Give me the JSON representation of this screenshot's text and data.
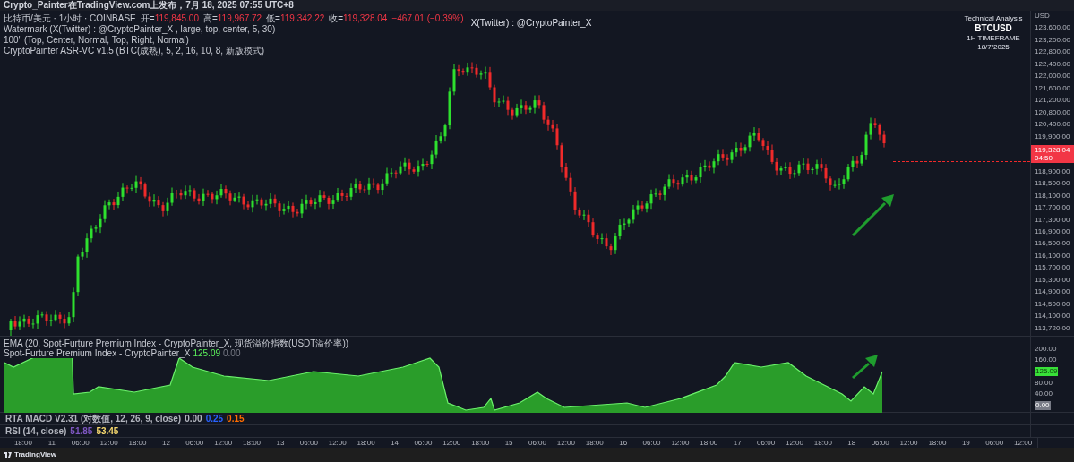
{
  "header": {
    "text": "Crypto_Painter在TradingView.com上发布，7月 18, 2025 07:55 UTC+8"
  },
  "legend": {
    "symbol": "比特币/美元 · 1小时 · COINBASE",
    "ohlc": [
      {
        "label": "开=",
        "value": "119,845.00"
      },
      {
        "label": "高=",
        "value": "119,967.72"
      },
      {
        "label": "低=",
        "value": "119,342.22"
      },
      {
        "label": "收=",
        "value": "119,328.04"
      }
    ],
    "change": "−467.01 (−0.39%)",
    "indicators": [
      "Watermark (X(Twitter) : @CryptoPainter_X , large, top, center, 5, 30)",
      "100\" (Top, Center, Normal, Top, Right, Normal)",
      "CryptoPainter ASR-VC v1.5 (BTC(成熟), 5, 2, 16, 10, 8, 新版模式)"
    ]
  },
  "watermark": "X(Twitter) : @CryptoPainter_X",
  "info_box": {
    "title": "Technical Analysis",
    "symbol": "BTCUSD",
    "timeframe": "1H TIMEFRAME",
    "date": "18/7/2025"
  },
  "price_axis": {
    "currency": "USD",
    "ticks_above": [
      "123,600.00",
      "123,200.00",
      "122,800.00",
      "122,400.00",
      "122,000.00",
      "121,600.00",
      "121,200.00",
      "120,800.00",
      "120,400.00",
      "119,900.00"
    ],
    "ticks_below": [
      "118,900.00",
      "118,500.00",
      "118,100.00",
      "117,700.00",
      "117,300.00",
      "116,900.00",
      "116,500.00",
      "116,100.00",
      "115,700.00",
      "115,300.00",
      "114,900.00",
      "114,500.00",
      "114,100.00",
      "113,720.00"
    ],
    "last_price": "119,328.04",
    "countdown": "04:50"
  },
  "premium_panel": {
    "ema_legend": "EMA (20, Spot-Furture Premium Index - CryptoPainter_X, 现货溢价指数(USDT溢价率))",
    "name": "Spot-Furture Premium Index - CryptoPainter_X",
    "value": "125.09",
    "value_2": "0.00",
    "ticks_above": [
      "200.00",
      "160.00"
    ],
    "value_badge": "125.09",
    "ticks_below": [
      "80.00",
      "40.00"
    ],
    "zero_badge": "0.00"
  },
  "macd": {
    "name": "RTA MACD V2.31 (对数值, 12, 26, 9, close)",
    "values": [
      {
        "text": "0.00",
        "color": "#b2b5be"
      },
      {
        "text": "0.25",
        "color": "#2962ff"
      },
      {
        "text": "0.15",
        "color": "#ff6d00"
      }
    ]
  },
  "rsi": {
    "name": "RSI (14, close)",
    "values": [
      {
        "text": "51.85",
        "color": "#7e57c2"
      },
      {
        "text": "53.45",
        "color": "#f5d76e"
      }
    ]
  },
  "time_axis": [
    "18:00",
    "11",
    "06:00",
    "12:00",
    "18:00",
    "12",
    "06:00",
    "12:00",
    "18:00",
    "13",
    "06:00",
    "12:00",
    "18:00",
    "14",
    "06:00",
    "12:00",
    "18:00",
    "15",
    "06:00",
    "12:00",
    "18:00",
    "16",
    "06:00",
    "12:00",
    "18:00",
    "17",
    "06:00",
    "12:00",
    "18:00",
    "18",
    "06:00",
    "12:00",
    "18:00",
    "19",
    "06:00",
    "12:00"
  ],
  "footer": {
    "brand": "TradingView"
  }
}
